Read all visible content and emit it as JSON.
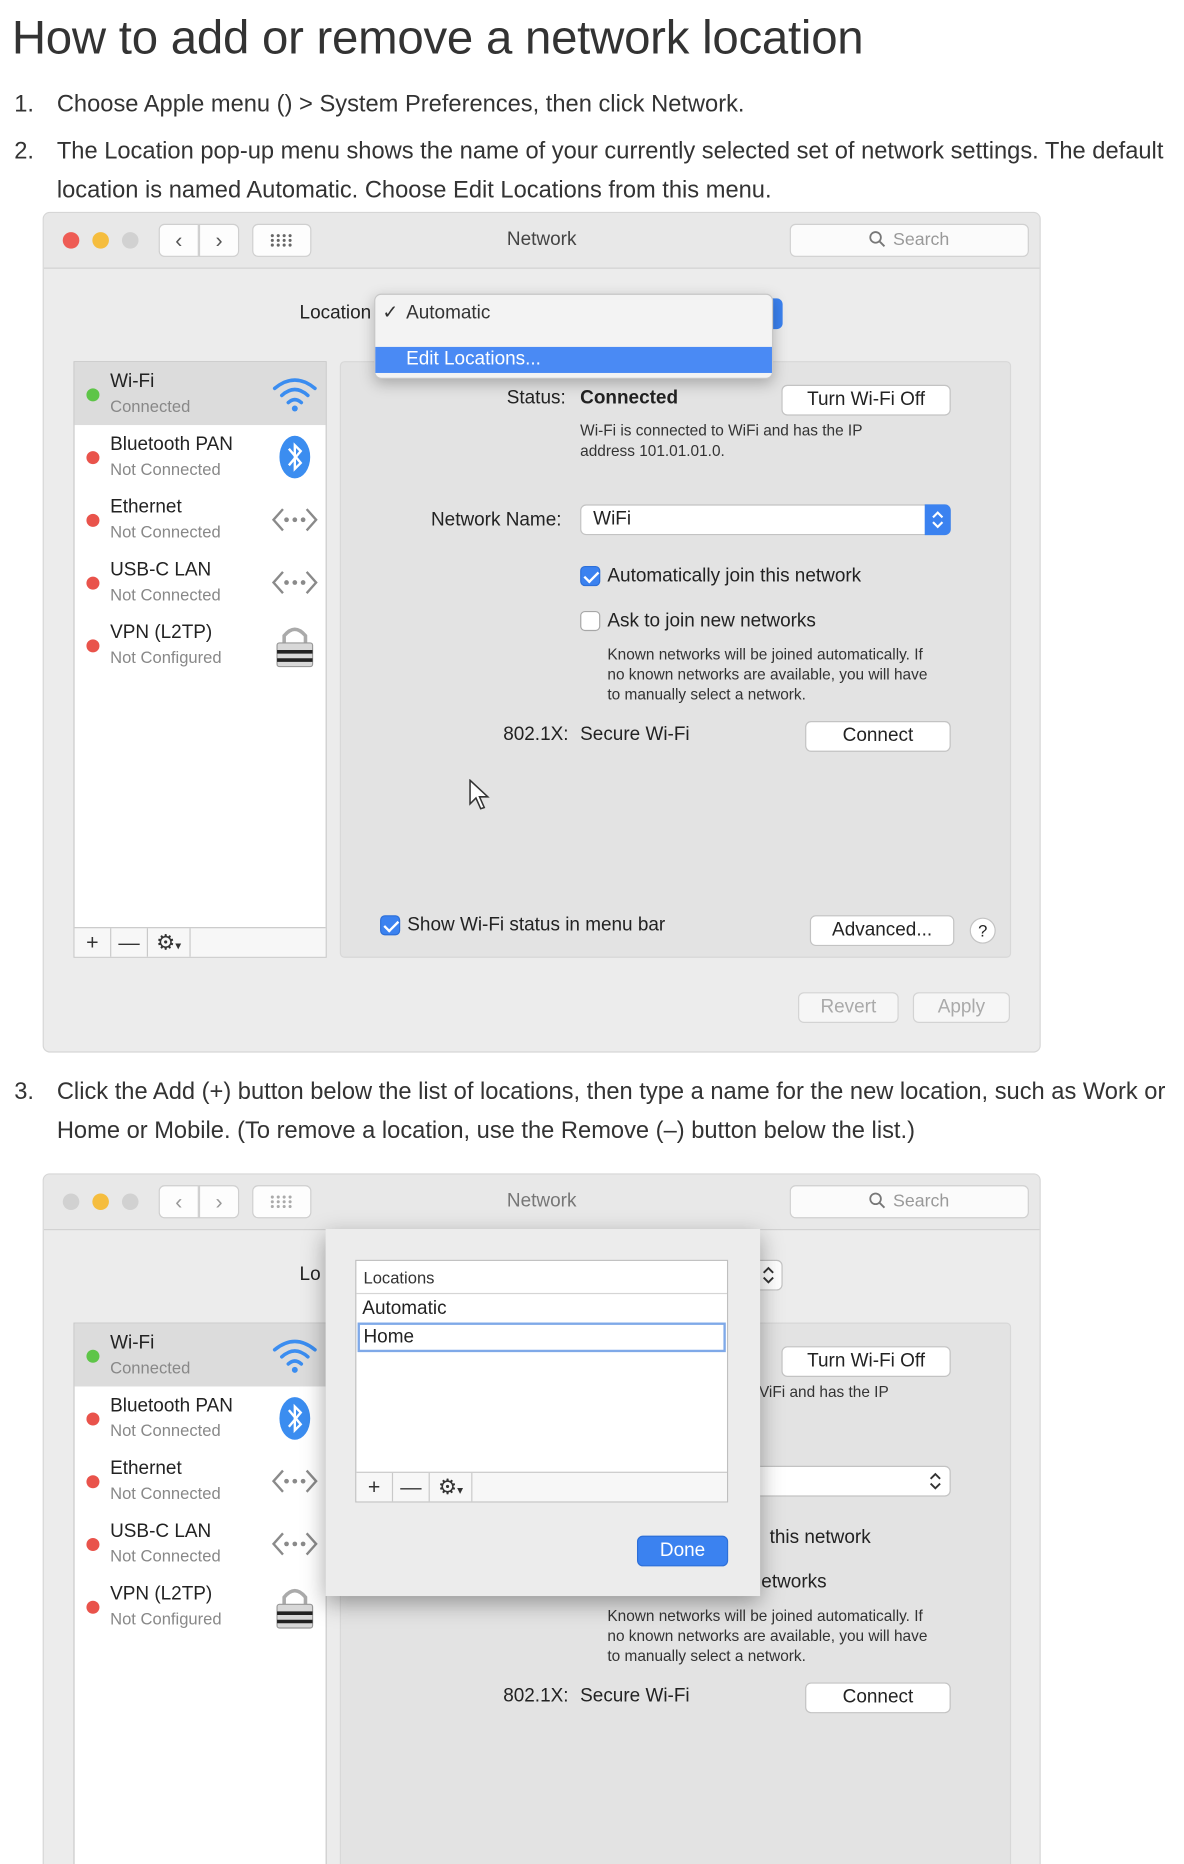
{
  "title": "How to add or remove a network location",
  "steps": [
    {
      "num": "1.",
      "text": "Choose Apple menu () > System Preferences, then click Network."
    },
    {
      "num": "2.",
      "text": "The Location pop-up menu shows the name of your currently selected set of network settings. The default location is named Automatic. Choose Edit Locations from this menu."
    },
    {
      "num": "3.",
      "text": "Click the Add (+) button below the list of locations, then type a name for the new location, such as Work or Home or Mobile. (To remove a location, use the Remove (–) button below the list.)"
    }
  ],
  "window": {
    "title": "Network",
    "search_placeholder": "Search",
    "location_label": "Location",
    "location_label_clipped": "Lo",
    "services": [
      {
        "name": "Wi-Fi",
        "status": "Connected",
        "dot": "#5ec548",
        "icon": "wifi-icon"
      },
      {
        "name": "Bluetooth PAN",
        "status": "Not Connected",
        "dot": "#e9534b",
        "icon": "bluetooth-icon"
      },
      {
        "name": "Ethernet",
        "status": "Not Connected",
        "dot": "#e9534b",
        "icon": "ethernet-icon"
      },
      {
        "name": "USB-C LAN",
        "status": "Not Connected",
        "dot": "#e9534b",
        "icon": "ethernet-icon"
      },
      {
        "name": "VPN (L2TP)",
        "status": "Not Configured",
        "dot": "#e9534b",
        "icon": "lock-icon"
      }
    ],
    "sidebar_buttons": {
      "add": "+",
      "remove": "—",
      "gear": "⚙"
    },
    "status_label": "Status:",
    "status_value": "Connected",
    "turn_off_button": "Turn Wi-Fi Off",
    "status_desc_1": "Wi-Fi is connected to WiFi and has the IP",
    "status_desc_2": "address 101.01.01.0.",
    "status_desc_clipped": "ViFi and has the IP",
    "network_name_label": "Network Name:",
    "network_name_value": "WiFi",
    "auto_join_label": "Automatically join this network",
    "auto_join_clipped": "this network",
    "ask_join_label": "Ask to join new networks",
    "ask_join_clipped": "etworks",
    "known_desc_1": "Known networks will be joined automatically. If",
    "known_desc_2": "no known networks are available, you will have",
    "known_desc_3": "to manually select a network.",
    "dot1x_label": "802.1X:",
    "dot1x_value": "Secure Wi-Fi",
    "connect_button": "Connect",
    "show_status_label": "Show Wi-Fi status in menu bar",
    "advanced_button": "Advanced...",
    "help_button": "?",
    "revert_button": "Revert",
    "apply_button": "Apply"
  },
  "location_menu": {
    "items": [
      "Automatic",
      "Edit Locations..."
    ],
    "checked": "✓"
  },
  "locations_sheet": {
    "header": "Locations",
    "items": [
      "Automatic",
      "Home"
    ],
    "done_button": "Done"
  },
  "colors": {
    "accent": "#3b82f0",
    "menu_highlight": "#4a8af4",
    "connected": "#5ec548",
    "disconnected": "#e9534b"
  }
}
